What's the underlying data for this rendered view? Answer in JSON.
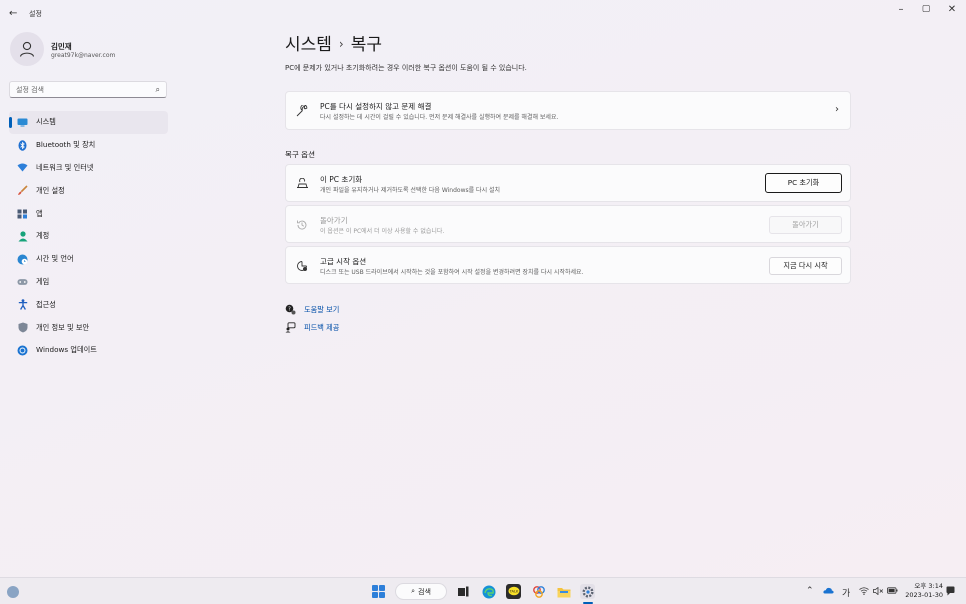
{
  "window": {
    "title": "설정",
    "back": "←",
    "minimize": "–",
    "maximize": "▢",
    "close": "✕"
  },
  "profile": {
    "name": "김민재",
    "email": "great97k@naver.com"
  },
  "search": {
    "placeholder": "설정 검색"
  },
  "sidebar": {
    "items": [
      {
        "label": "시스템",
        "icon": "monitor-icon",
        "active": true
      },
      {
        "label": "Bluetooth 및 장치",
        "icon": "bluetooth-icon"
      },
      {
        "label": "네트워크 및 인터넷",
        "icon": "wifi-icon"
      },
      {
        "label": "개인 설정",
        "icon": "brush-icon"
      },
      {
        "label": "앱",
        "icon": "apps-icon"
      },
      {
        "label": "계정",
        "icon": "person-icon"
      },
      {
        "label": "시간 및 언어",
        "icon": "globe-clock-icon"
      },
      {
        "label": "게임",
        "icon": "gamepad-icon"
      },
      {
        "label": "접근성",
        "icon": "accessibility-icon"
      },
      {
        "label": "개인 정보 및 보안",
        "icon": "shield-icon"
      },
      {
        "label": "Windows 업데이트",
        "icon": "update-icon"
      }
    ]
  },
  "main": {
    "breadcrumb_parent": "시스템",
    "breadcrumb_sep": "›",
    "breadcrumb_current": "복구",
    "description": "PC에 문제가 있거나 초기화하려는 경우 이러한 복구 옵션이 도움이 될 수 있습니다.",
    "troubleshoot": {
      "title": "PC를 다시 설정하지 않고 문제 해결",
      "desc": "다시 설정하는 데 시간이 걸릴 수 있습니다. 먼저 문제 해결사를 실행하여 문제를 해결해 보세요.",
      "chevron": "›"
    },
    "section_label": "복구 옵션",
    "options": [
      {
        "title": "이 PC 초기화",
        "desc": "개인 파일을 유지하거나 제거하도록 선택한 다음 Windows를 다시 설치",
        "button": "PC 초기화",
        "enabled": true
      },
      {
        "title": "돌아가기",
        "desc": "이 옵션은 이 PC에서 더 이상 사용할 수 없습니다.",
        "button": "돌아가기",
        "enabled": false
      },
      {
        "title": "고급 시작 옵션",
        "desc": "디스크 또는 USB 드라이브에서 시작하는 것을 포함하여 시작 설정을 변경하려면 장치를 다시 시작하세요.",
        "button": "지금 다시 시작",
        "enabled": true
      }
    ],
    "links": [
      {
        "label": "도움말 보기",
        "icon": "help-icon"
      },
      {
        "label": "피드백 제공",
        "icon": "feedback-icon"
      }
    ]
  },
  "taskbar": {
    "search_label": "검색",
    "ime": "가",
    "time": "오후 3:14",
    "date": "2023-01-30"
  }
}
